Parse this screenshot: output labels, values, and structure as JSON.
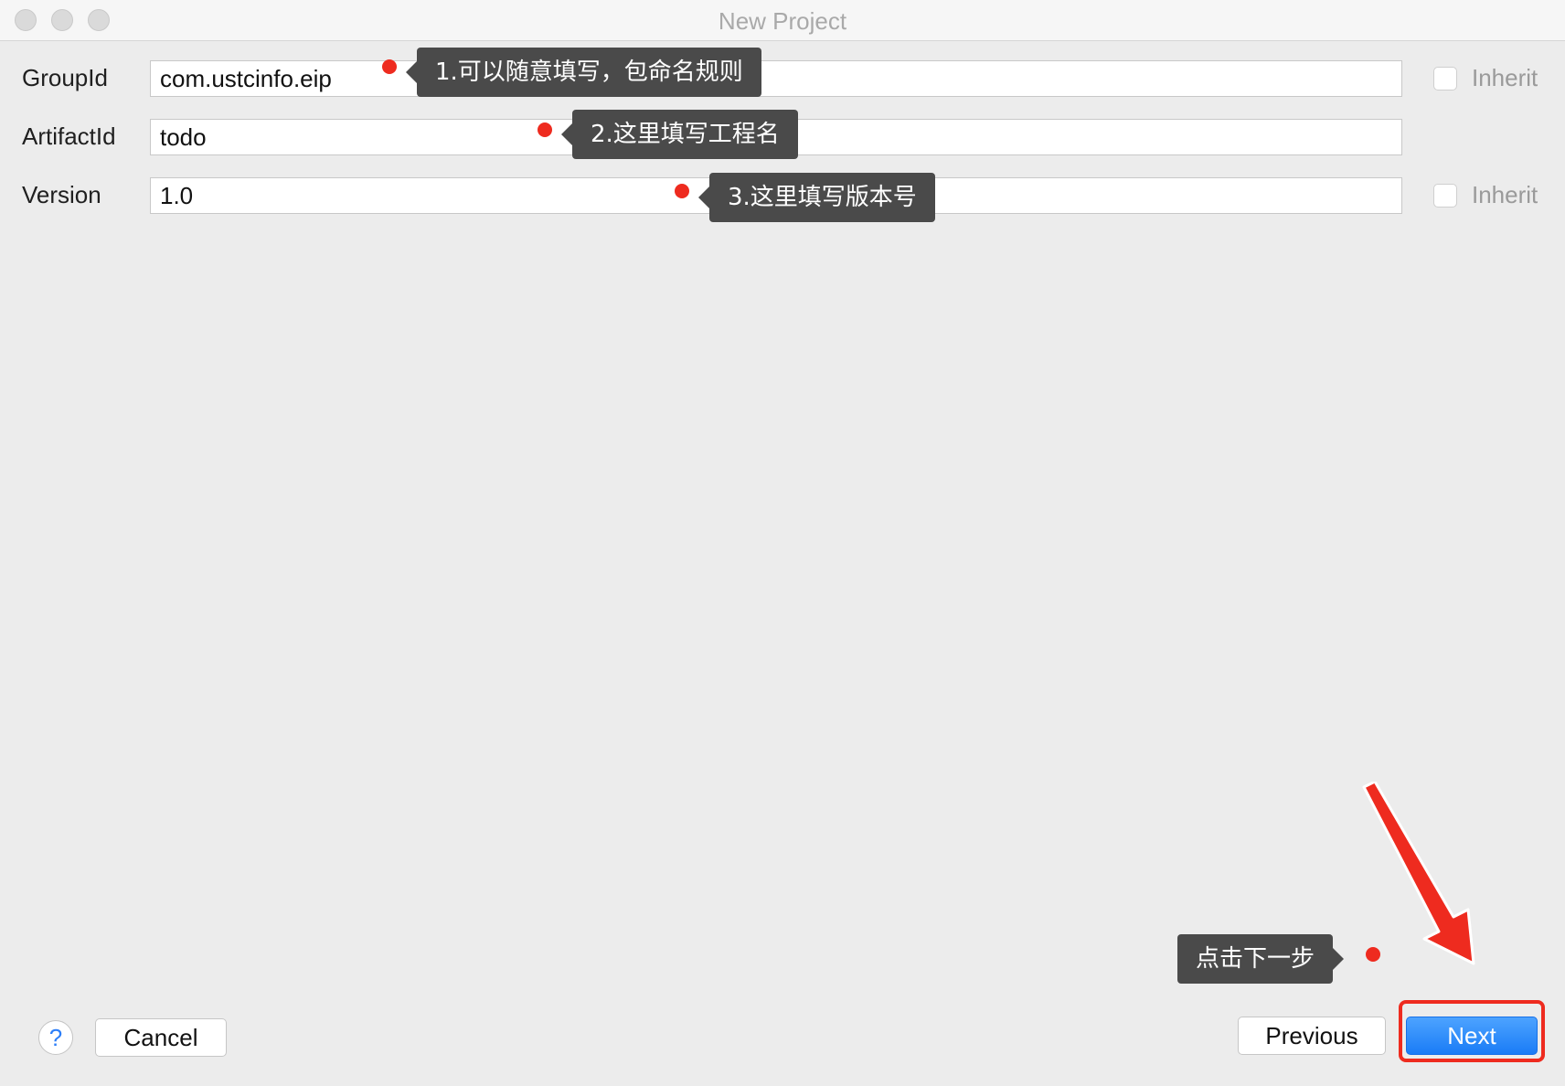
{
  "window": {
    "title": "New Project"
  },
  "form": {
    "group_id": {
      "label": "GroupId",
      "value": "com.ustcinfo.eip",
      "inherit_label": "Inherit"
    },
    "artifact_id": {
      "label": "ArtifactId",
      "value": "todo"
    },
    "version": {
      "label": "Version",
      "value": "1.0",
      "inherit_label": "Inherit"
    }
  },
  "annotations": {
    "tip1": "1.可以随意填写，包命名规则",
    "tip2": "2.这里填写工程名",
    "tip3": "3.这里填写版本号",
    "tip_next": "点击下一步",
    "marker_color": "#ee2b1f"
  },
  "footer": {
    "help_label": "?",
    "cancel_label": "Cancel",
    "previous_label": "Previous",
    "next_label": "Next"
  },
  "icons": {
    "help": "question-mark-icon",
    "arrow": "red-arrow-icon"
  }
}
